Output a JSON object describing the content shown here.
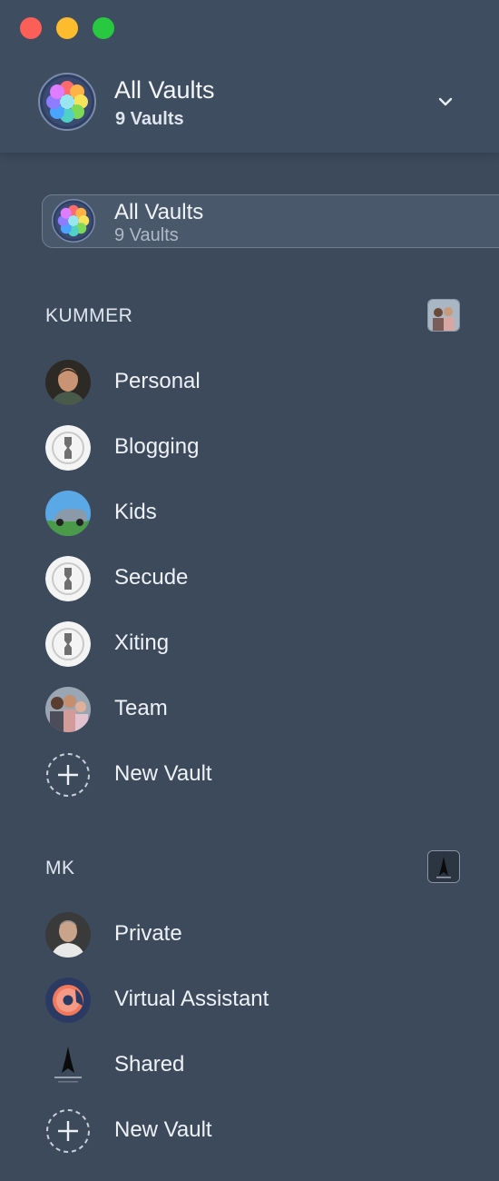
{
  "header": {
    "title": "All Vaults",
    "subtitle": "9 Vaults"
  },
  "selected_vault": {
    "title": "All Vaults",
    "subtitle": "9 Vaults"
  },
  "accounts": [
    {
      "name": "KUMMER",
      "vaults": [
        {
          "label": "Personal",
          "icon": "avatar-man-icon"
        },
        {
          "label": "Blogging",
          "icon": "vault-key-icon"
        },
        {
          "label": "Kids",
          "icon": "car-icon"
        },
        {
          "label": "Secude",
          "icon": "vault-key-icon"
        },
        {
          "label": "Xiting",
          "icon": "vault-key-icon"
        },
        {
          "label": "Team",
          "icon": "group-photo-icon"
        }
      ],
      "new_vault_label": "New Vault"
    },
    {
      "name": "MK",
      "vaults": [
        {
          "label": "Private",
          "icon": "avatar-man-icon"
        },
        {
          "label": "Virtual Assistant",
          "icon": "donut-icon"
        },
        {
          "label": "Shared",
          "icon": "logo-icon"
        }
      ],
      "new_vault_label": "New Vault"
    }
  ],
  "colors": {
    "background": "#3c4a5c",
    "header": "#3f4d60",
    "close": "#fc5f57",
    "minimize": "#fdbc2e",
    "zoom": "#28c840"
  }
}
